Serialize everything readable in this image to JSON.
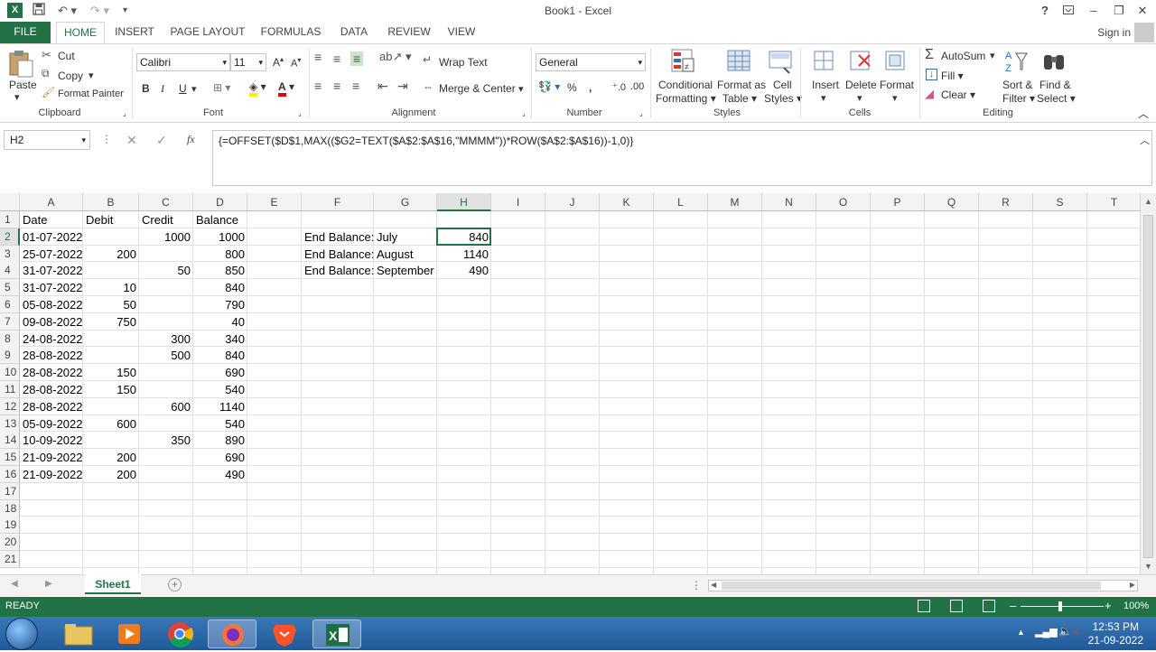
{
  "window": {
    "title": "Book1 - Excel",
    "help": "?",
    "signin": "Sign in"
  },
  "tabs": [
    {
      "label": "FILE",
      "x": 0
    },
    {
      "label": "HOME"
    },
    {
      "label": "INSERT"
    },
    {
      "label": "PAGE LAYOUT"
    },
    {
      "label": "FORMULAS"
    },
    {
      "label": "DATA"
    },
    {
      "label": "REVIEW"
    },
    {
      "label": "VIEW"
    }
  ],
  "ribbon": {
    "clipboard": {
      "paste": "Paste",
      "cut": "Cut",
      "copy": "Copy",
      "format_painter": "Format Painter",
      "label": "Clipboard"
    },
    "font": {
      "name": "Calibri",
      "size": "11",
      "label": "Font"
    },
    "alignment": {
      "wrap": "Wrap Text",
      "merge": "Merge & Center",
      "label": "Alignment"
    },
    "number": {
      "format": "General",
      "label": "Number"
    },
    "styles": {
      "cond": "Conditional",
      "cond2": "Formatting",
      "fmt_table": "Format as",
      "fmt_table2": "Table",
      "cell_styles": "Cell",
      "cell_styles2": "Styles",
      "label": "Styles"
    },
    "cells": {
      "insert": "Insert",
      "delete": "Delete",
      "format": "Format",
      "label": "Cells"
    },
    "editing": {
      "autosum": "AutoSum",
      "fill": "Fill",
      "clear": "Clear",
      "sort": "Sort &",
      "sort2": "Filter",
      "find": "Find &",
      "find2": "Select",
      "label": "Editing"
    }
  },
  "formula_bar": {
    "name_box": "H2",
    "fx": "fx",
    "formula": "{=OFFSET($D$1,MAX(($G2=TEXT($A$2:$A$16,\"MMMM\"))*ROW($A$2:$A$16))-1,0)}"
  },
  "columns": [
    "A",
    "B",
    "C",
    "D",
    "E",
    "F",
    "G",
    "H",
    "I",
    "J",
    "K",
    "L",
    "M",
    "N",
    "O",
    "P",
    "Q",
    "R",
    "S",
    "T"
  ],
  "rows": [
    "1",
    "2",
    "3",
    "4",
    "5",
    "6",
    "7",
    "8",
    "9",
    "10",
    "11",
    "12",
    "13",
    "14",
    "15",
    "16",
    "17",
    "18",
    "19",
    "20",
    "21"
  ],
  "cells": {
    "header": [
      "Date",
      "Debit",
      "Credit",
      "Balance"
    ],
    "data": [
      [
        "01-07-2022",
        "",
        "1000",
        "1000"
      ],
      [
        "25-07-2022",
        "200",
        "",
        "800"
      ],
      [
        "31-07-2022",
        "",
        "50",
        "850"
      ],
      [
        "31-07-2022",
        "10",
        "",
        "840"
      ],
      [
        "05-08-2022",
        "50",
        "",
        "790"
      ],
      [
        "09-08-2022",
        "750",
        "",
        "40"
      ],
      [
        "24-08-2022",
        "",
        "300",
        "340"
      ],
      [
        "28-08-2022",
        "",
        "500",
        "840"
      ],
      [
        "28-08-2022",
        "150",
        "",
        "690"
      ],
      [
        "28-08-2022",
        "150",
        "",
        "540"
      ],
      [
        "28-08-2022",
        "",
        "600",
        "1140"
      ],
      [
        "05-09-2022",
        "600",
        "",
        "540"
      ],
      [
        "10-09-2022",
        "",
        "350",
        "890"
      ],
      [
        "21-09-2022",
        "200",
        "",
        "690"
      ],
      [
        "21-09-2022",
        "200",
        "",
        "490"
      ]
    ],
    "summary": [
      {
        "label": "End Balance:",
        "month": "July",
        "value": "840"
      },
      {
        "label": "End Balance:",
        "month": "August",
        "value": "1140"
      },
      {
        "label": "End Balance:",
        "month": "September",
        "value": "490"
      }
    ]
  },
  "sheet": {
    "name": "Sheet1"
  },
  "status": {
    "ready": "READY",
    "zoom": "100%"
  },
  "taskbar": {
    "time": "12:53 PM",
    "date": "21-09-2022"
  }
}
